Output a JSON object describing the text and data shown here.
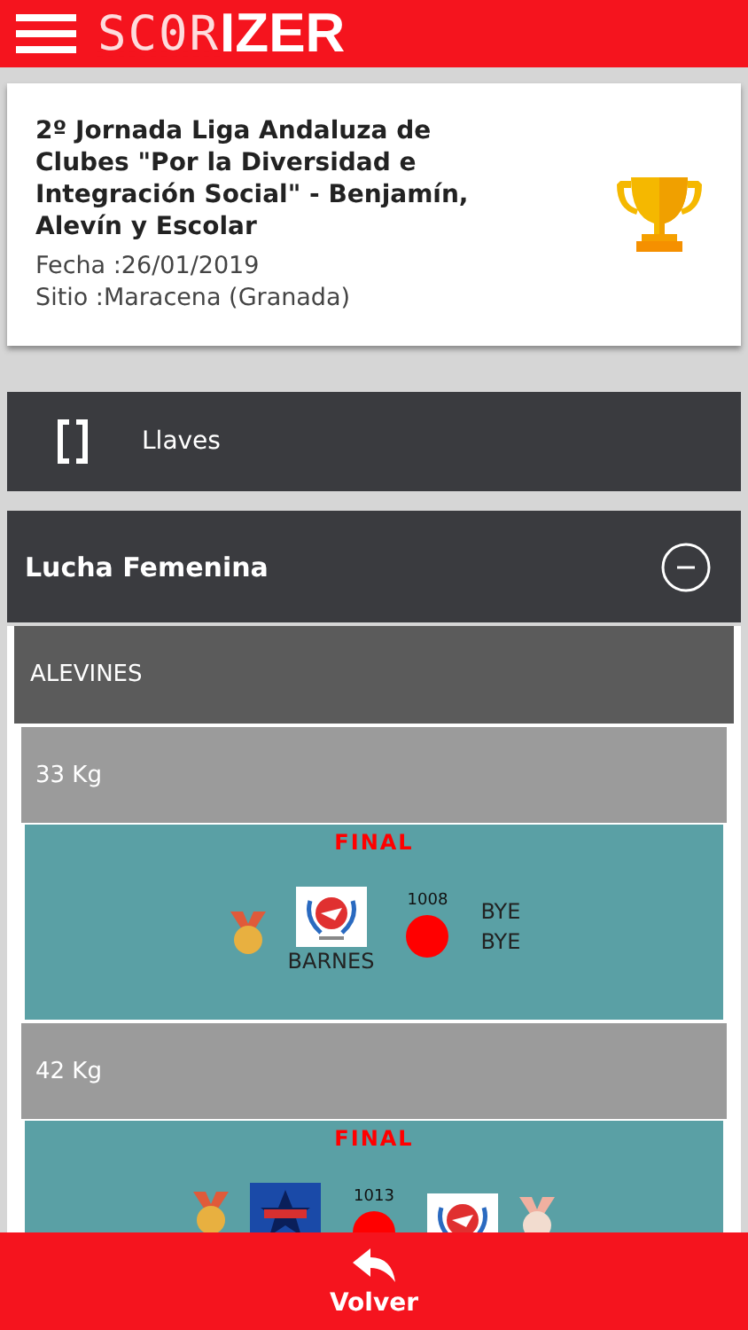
{
  "header": {
    "logo_dotted": "SC0R",
    "logo_bold": "IZER"
  },
  "event": {
    "title": "2º Jornada Liga Andaluza de Clubes \"Por la Diversidad e Integración Social\" - Benjamín, Alevín y Escolar",
    "date": "Fecha :26/01/2019",
    "place": "Sitio :Maracena (Granada)"
  },
  "brackets_button": {
    "label": "Llaves"
  },
  "section": {
    "title": "Lucha Femenina",
    "expanded": true,
    "category": "ALEVINES",
    "weights": [
      {
        "label": "33 Kg",
        "match": {
          "round": "FINAL",
          "number": "1008",
          "left": {
            "medal": true,
            "color": "#e8b040",
            "logo": {
              "kind": "picture"
            },
            "names": [
              "BARNES"
            ]
          },
          "right": {
            "medal": false,
            "names": [
              "BYE",
              "BYE"
            ]
          }
        }
      },
      {
        "label": "42 Kg",
        "match": {
          "round": "FINAL",
          "number": "1013",
          "left": {
            "medal": true,
            "color": "#e8b040",
            "logo": {
              "kind": "picture"
            }
          },
          "right": {
            "medal": true,
            "color": "#f2dccf",
            "logo": {
              "kind": "picture"
            }
          }
        }
      }
    ]
  },
  "footer": {
    "label": "Volver"
  }
}
